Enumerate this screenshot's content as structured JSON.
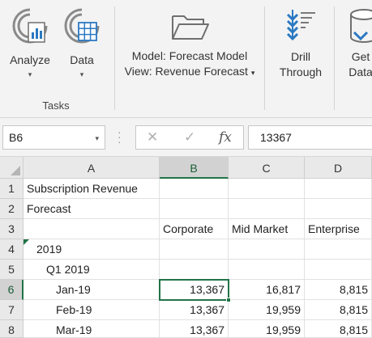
{
  "ribbon": {
    "analyze_label": "Analyze",
    "data_label": "Data",
    "tasks_group": "Tasks",
    "model_line": "Model: Forecast Model",
    "view_line": "View: Revenue Forecast",
    "drill_line1": "Drill",
    "drill_line2": "Through",
    "get_line1": "Get",
    "get_line2": "Data",
    "dropdown_caret": "▾"
  },
  "formula_bar": {
    "name_box": "B6",
    "cancel_glyph": "✕",
    "enter_glyph": "✓",
    "fx_glyph": "fx",
    "value": "13367"
  },
  "sheet": {
    "columns": [
      "A",
      "B",
      "C",
      "D"
    ],
    "rows": [
      "1",
      "2",
      "3",
      "4",
      "5",
      "6",
      "7",
      "8"
    ],
    "selected_column": "B",
    "selected_row": "6",
    "cells": {
      "a1": "Subscription Revenue",
      "a2": "Forecast",
      "b3": "Corporate",
      "c3": "Mid Market",
      "d3": "Enterprise",
      "a4": "2019",
      "a5": "Q1 2019",
      "a6": "Jan-19",
      "b6": "13,367",
      "c6": "16,817",
      "d6": "8,815",
      "a7": "Feb-19",
      "b7": "13,367",
      "c7": "19,959",
      "d7": "8,815",
      "a8": "Mar-19",
      "b8": "13,367",
      "c8": "19,959",
      "d8": "8,815"
    }
  },
  "colors": {
    "accent": "#217346",
    "icon_blue": "#2b79c2",
    "icon_gray": "#7a7a7a"
  }
}
